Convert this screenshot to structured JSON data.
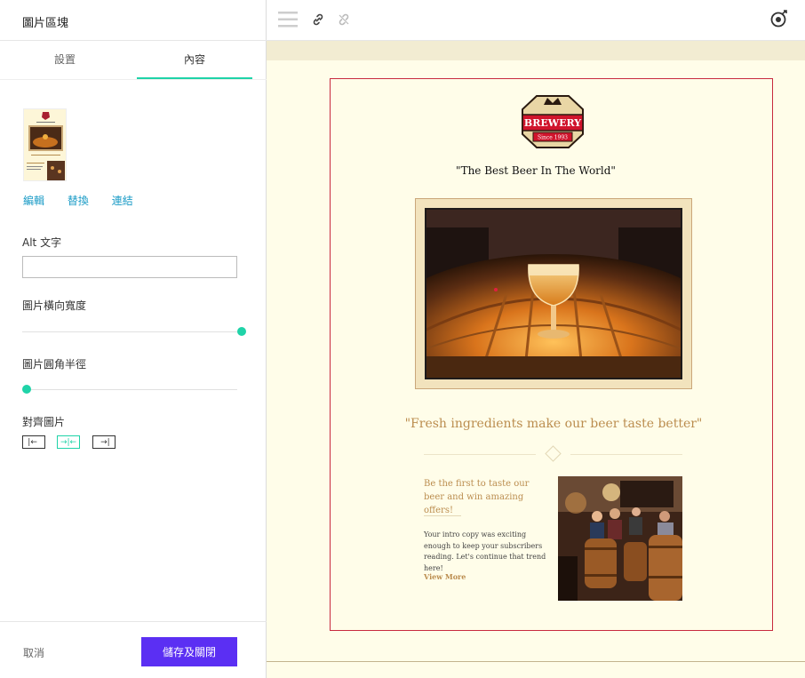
{
  "panel": {
    "title": "圖片區塊",
    "tabs": [
      {
        "label": "設置"
      },
      {
        "label": "內容"
      }
    ],
    "active_tab": "內容",
    "image_actions": {
      "edit": "編輯",
      "replace": "替換",
      "link": "連結"
    },
    "alt_text": {
      "label": "Alt 文字",
      "value": ""
    },
    "width": {
      "label": "圖片橫向寬度",
      "value_fraction": 1.0
    },
    "radius": {
      "label": "圖片圓角半徑",
      "value_fraction": 0.0
    },
    "align": {
      "label": "對齊圖片",
      "options": [
        "left",
        "center",
        "right"
      ],
      "selected": "center"
    },
    "cancel_label": "取消",
    "save_label": "儲存及關閉"
  },
  "toolbar": {
    "icons": [
      "menu-icon",
      "link-icon",
      "unlink-icon",
      "app-logo-icon"
    ]
  },
  "email": {
    "logo": {
      "main": "BREWERY",
      "sub": "Since 1993"
    },
    "tagline": "\"The Best Beer In The World\"",
    "quote": "\"Fresh ingredients make our beer taste better\"",
    "promo_title": "Be the first to taste our beer and win amazing offers!",
    "intro": "Your intro copy was exciting enough to keep your subscribers reading. Let's continue that trend here!",
    "view_more": "View More"
  },
  "colors": {
    "accent": "#1fd3a8",
    "save_button": "#5b2ff3",
    "link": "#1a9bc6",
    "canvas_bg": "#fffde9",
    "gold_text": "#bb8d4f",
    "selection_border": "#c82a3e",
    "logo_red": "#d0142c"
  }
}
